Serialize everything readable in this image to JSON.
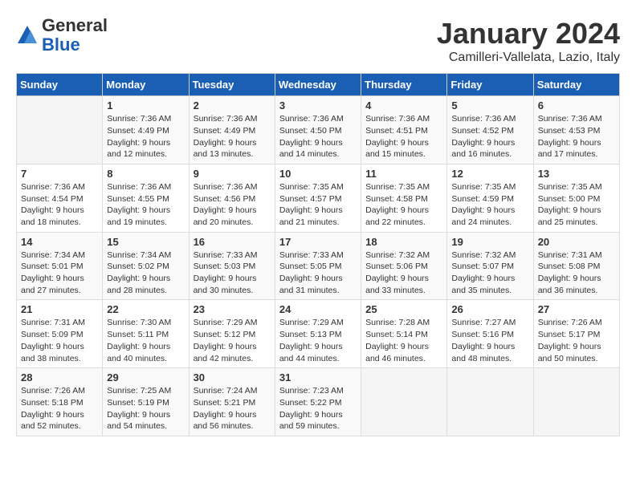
{
  "header": {
    "logo_general": "General",
    "logo_blue": "Blue",
    "main_title": "January 2024",
    "subtitle": "Camilleri-Vallelata, Lazio, Italy"
  },
  "calendar": {
    "days_of_week": [
      "Sunday",
      "Monday",
      "Tuesday",
      "Wednesday",
      "Thursday",
      "Friday",
      "Saturday"
    ],
    "weeks": [
      [
        {
          "day": "",
          "info": ""
        },
        {
          "day": "1",
          "info": "Sunrise: 7:36 AM\nSunset: 4:49 PM\nDaylight: 9 hours\nand 12 minutes."
        },
        {
          "day": "2",
          "info": "Sunrise: 7:36 AM\nSunset: 4:49 PM\nDaylight: 9 hours\nand 13 minutes."
        },
        {
          "day": "3",
          "info": "Sunrise: 7:36 AM\nSunset: 4:50 PM\nDaylight: 9 hours\nand 14 minutes."
        },
        {
          "day": "4",
          "info": "Sunrise: 7:36 AM\nSunset: 4:51 PM\nDaylight: 9 hours\nand 15 minutes."
        },
        {
          "day": "5",
          "info": "Sunrise: 7:36 AM\nSunset: 4:52 PM\nDaylight: 9 hours\nand 16 minutes."
        },
        {
          "day": "6",
          "info": "Sunrise: 7:36 AM\nSunset: 4:53 PM\nDaylight: 9 hours\nand 17 minutes."
        }
      ],
      [
        {
          "day": "7",
          "info": "Sunrise: 7:36 AM\nSunset: 4:54 PM\nDaylight: 9 hours\nand 18 minutes."
        },
        {
          "day": "8",
          "info": "Sunrise: 7:36 AM\nSunset: 4:55 PM\nDaylight: 9 hours\nand 19 minutes."
        },
        {
          "day": "9",
          "info": "Sunrise: 7:36 AM\nSunset: 4:56 PM\nDaylight: 9 hours\nand 20 minutes."
        },
        {
          "day": "10",
          "info": "Sunrise: 7:35 AM\nSunset: 4:57 PM\nDaylight: 9 hours\nand 21 minutes."
        },
        {
          "day": "11",
          "info": "Sunrise: 7:35 AM\nSunset: 4:58 PM\nDaylight: 9 hours\nand 22 minutes."
        },
        {
          "day": "12",
          "info": "Sunrise: 7:35 AM\nSunset: 4:59 PM\nDaylight: 9 hours\nand 24 minutes."
        },
        {
          "day": "13",
          "info": "Sunrise: 7:35 AM\nSunset: 5:00 PM\nDaylight: 9 hours\nand 25 minutes."
        }
      ],
      [
        {
          "day": "14",
          "info": "Sunrise: 7:34 AM\nSunset: 5:01 PM\nDaylight: 9 hours\nand 27 minutes."
        },
        {
          "day": "15",
          "info": "Sunrise: 7:34 AM\nSunset: 5:02 PM\nDaylight: 9 hours\nand 28 minutes."
        },
        {
          "day": "16",
          "info": "Sunrise: 7:33 AM\nSunset: 5:03 PM\nDaylight: 9 hours\nand 30 minutes."
        },
        {
          "day": "17",
          "info": "Sunrise: 7:33 AM\nSunset: 5:05 PM\nDaylight: 9 hours\nand 31 minutes."
        },
        {
          "day": "18",
          "info": "Sunrise: 7:32 AM\nSunset: 5:06 PM\nDaylight: 9 hours\nand 33 minutes."
        },
        {
          "day": "19",
          "info": "Sunrise: 7:32 AM\nSunset: 5:07 PM\nDaylight: 9 hours\nand 35 minutes."
        },
        {
          "day": "20",
          "info": "Sunrise: 7:31 AM\nSunset: 5:08 PM\nDaylight: 9 hours\nand 36 minutes."
        }
      ],
      [
        {
          "day": "21",
          "info": "Sunrise: 7:31 AM\nSunset: 5:09 PM\nDaylight: 9 hours\nand 38 minutes."
        },
        {
          "day": "22",
          "info": "Sunrise: 7:30 AM\nSunset: 5:11 PM\nDaylight: 9 hours\nand 40 minutes."
        },
        {
          "day": "23",
          "info": "Sunrise: 7:29 AM\nSunset: 5:12 PM\nDaylight: 9 hours\nand 42 minutes."
        },
        {
          "day": "24",
          "info": "Sunrise: 7:29 AM\nSunset: 5:13 PM\nDaylight: 9 hours\nand 44 minutes."
        },
        {
          "day": "25",
          "info": "Sunrise: 7:28 AM\nSunset: 5:14 PM\nDaylight: 9 hours\nand 46 minutes."
        },
        {
          "day": "26",
          "info": "Sunrise: 7:27 AM\nSunset: 5:16 PM\nDaylight: 9 hours\nand 48 minutes."
        },
        {
          "day": "27",
          "info": "Sunrise: 7:26 AM\nSunset: 5:17 PM\nDaylight: 9 hours\nand 50 minutes."
        }
      ],
      [
        {
          "day": "28",
          "info": "Sunrise: 7:26 AM\nSunset: 5:18 PM\nDaylight: 9 hours\nand 52 minutes."
        },
        {
          "day": "29",
          "info": "Sunrise: 7:25 AM\nSunset: 5:19 PM\nDaylight: 9 hours\nand 54 minutes."
        },
        {
          "day": "30",
          "info": "Sunrise: 7:24 AM\nSunset: 5:21 PM\nDaylight: 9 hours\nand 56 minutes."
        },
        {
          "day": "31",
          "info": "Sunrise: 7:23 AM\nSunset: 5:22 PM\nDaylight: 9 hours\nand 59 minutes."
        },
        {
          "day": "",
          "info": ""
        },
        {
          "day": "",
          "info": ""
        },
        {
          "day": "",
          "info": ""
        }
      ]
    ]
  }
}
